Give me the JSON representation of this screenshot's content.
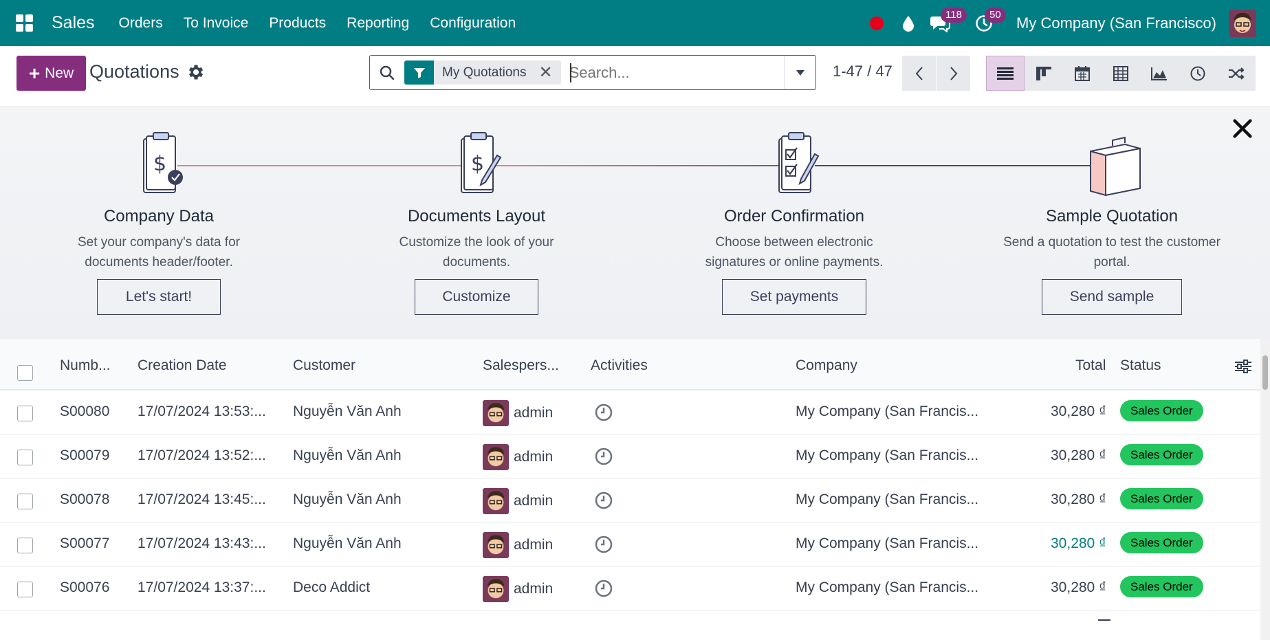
{
  "navbar": {
    "app_name": "Sales",
    "menu": [
      "Orders",
      "To Invoice",
      "Products",
      "Reporting",
      "Configuration"
    ],
    "messages_count": "118",
    "activities_count": "50",
    "company": "My Company (San Francisco)"
  },
  "control": {
    "new_label": "New",
    "title": "Quotations",
    "facet_label": "My Quotations",
    "search_placeholder": "Search...",
    "pager": "1-47 / 47"
  },
  "onboarding": {
    "steps": [
      {
        "title": "Company Data",
        "desc": "Set your company's data for documents header/footer.",
        "button": "Let's start!"
      },
      {
        "title": "Documents Layout",
        "desc": "Customize the look of your documents.",
        "button": "Customize"
      },
      {
        "title": "Order Confirmation",
        "desc": "Choose between electronic signatures or online payments.",
        "button": "Set payments"
      },
      {
        "title": "Sample Quotation",
        "desc": "Send a quotation to test the customer portal.",
        "button": "Send sample"
      }
    ]
  },
  "table": {
    "columns": [
      "Numb...",
      "Creation Date",
      "Customer",
      "Salespers...",
      "Activities",
      "Company",
      "Total",
      "Status"
    ],
    "rows": [
      {
        "number": "S00080",
        "date": "17/07/2024 13:53:...",
        "customer": "Nguyễn Văn Anh",
        "salesperson": "admin",
        "company": "My Company (San Francis...",
        "total": "30,280 ₫",
        "status": "Sales Order"
      },
      {
        "number": "S00079",
        "date": "17/07/2024 13:52:...",
        "customer": "Nguyễn Văn Anh",
        "salesperson": "admin",
        "company": "My Company (San Francis...",
        "total": "30,280 ₫",
        "status": "Sales Order"
      },
      {
        "number": "S00078",
        "date": "17/07/2024 13:45:...",
        "customer": "Nguyễn Văn Anh",
        "salesperson": "admin",
        "company": "My Company (San Francis...",
        "total": "30,280 ₫",
        "status": "Sales Order"
      },
      {
        "number": "S00077",
        "date": "17/07/2024 13:43:...",
        "customer": "Nguyễn Văn Anh",
        "salesperson": "admin",
        "company": "My Company (San Francis...",
        "total": "30,280 ₫",
        "status": "Sales Order"
      },
      {
        "number": "S00076",
        "date": "17/07/2024 13:37:...",
        "customer": "Deco Addict",
        "salesperson": "admin",
        "company": "My Company (San Francis...",
        "total": "30,280 ₫",
        "status": "Sales Order"
      }
    ]
  },
  "colors": {
    "navbar": "#017e84",
    "primary": "#862e7e",
    "status_green": "#22c55e",
    "link": "#017e84"
  },
  "icons": [
    "apps-grid-icon",
    "recording-icon",
    "droplet-icon",
    "chat-icon",
    "clock-icon",
    "search-icon",
    "filter-icon",
    "gear-icon",
    "close-icon",
    "list-view-icon",
    "kanban-view-icon",
    "calendar-view-icon",
    "pivot-view-icon",
    "graph-view-icon",
    "activity-view-icon",
    "cohort-view-icon",
    "optional-columns-icon"
  ]
}
